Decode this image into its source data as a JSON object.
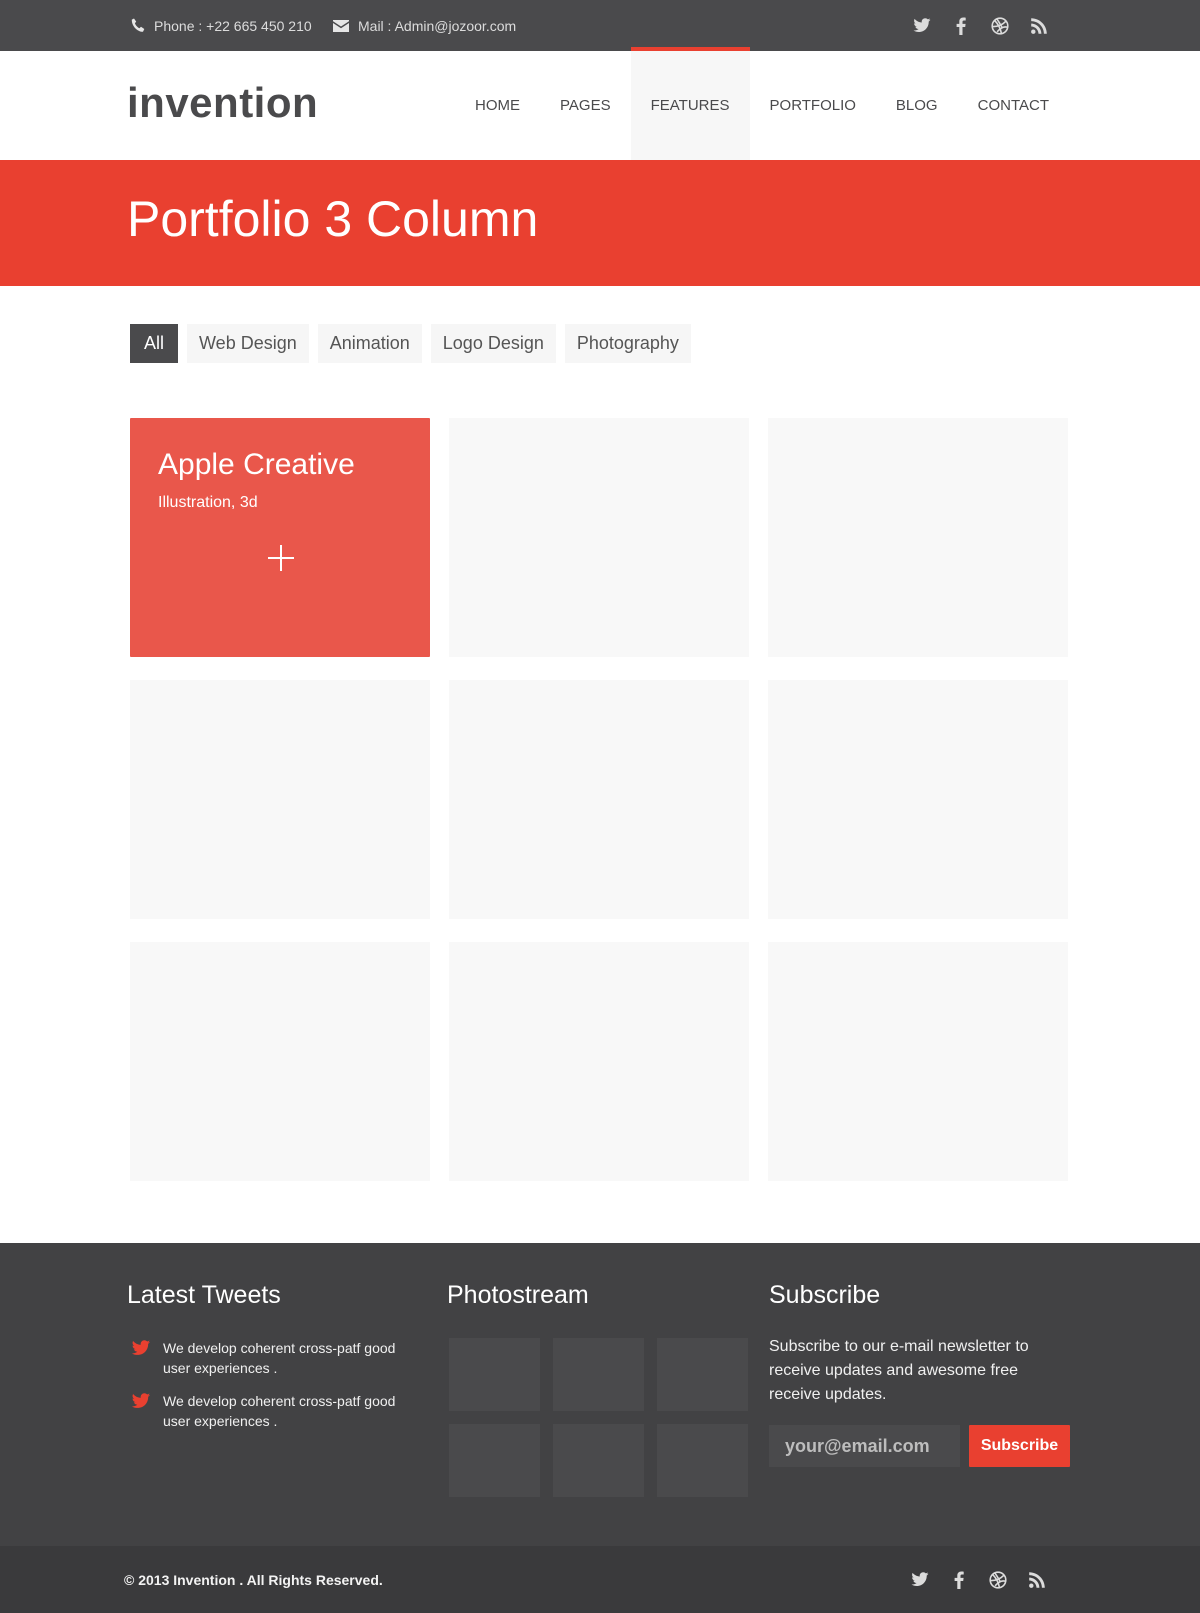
{
  "topbar": {
    "phone": "Phone : +22 665 450 210",
    "mail": "Mail : Admin@jozoor.com",
    "social_icons": [
      "twitter-icon",
      "facebook-icon",
      "dribbble-icon",
      "rss-icon"
    ]
  },
  "header": {
    "logo": "invention",
    "nav": [
      "HOME",
      "PAGES",
      "FEATURES",
      "PORTFOLIO",
      "BLOG",
      "CONTACT"
    ],
    "active_nav": "FEATURES"
  },
  "page": {
    "title": "Portfolio 3 Column"
  },
  "filters": {
    "items": [
      "All",
      "Web Design",
      "Animation",
      "Logo Design",
      "Photography"
    ],
    "active": "All"
  },
  "portfolio": {
    "featured": {
      "title": "Apple Creative",
      "subtitle": "Illustration, 3d"
    }
  },
  "footer": {
    "tweets": {
      "title": "Latest Tweets",
      "items": [
        "We develop coherent cross-patf good user experiences .",
        "We develop coherent cross-patf good user experiences ."
      ]
    },
    "photostream": {
      "title": "Photostream"
    },
    "subscribe": {
      "title": "Subscribe",
      "text": "Subscribe to our e-mail newsletter to receive updates and awesome free receive updates.",
      "placeholder": "your@email.com",
      "button": "Subscribe"
    }
  },
  "bottombar": {
    "copyright": "© 2013 Invention . All Rights Reserved."
  },
  "colors": {
    "accent": "#e94030",
    "dark": "#4a4a4c",
    "footer": "#424244",
    "bottom": "#3a3a3c"
  }
}
